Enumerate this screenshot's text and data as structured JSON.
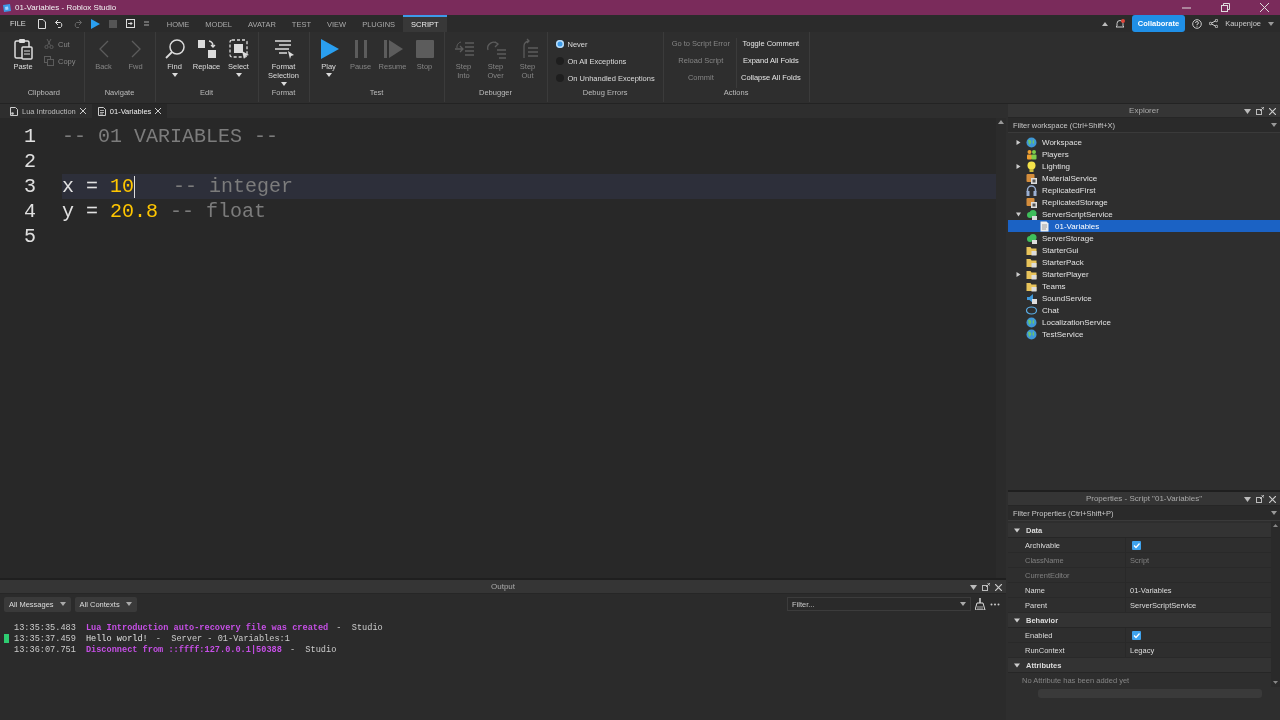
{
  "window": {
    "title": "01-Variables - Roblox Studio"
  },
  "menubar": {
    "file": "FILE",
    "tabs": [
      {
        "label": "HOME",
        "selected": false
      },
      {
        "label": "MODEL",
        "selected": false
      },
      {
        "label": "AVATAR",
        "selected": false
      },
      {
        "label": "TEST",
        "selected": false
      },
      {
        "label": "VIEW",
        "selected": false
      },
      {
        "label": "PLUGINS",
        "selected": false
      },
      {
        "label": "SCRIPT",
        "selected": true
      }
    ]
  },
  "account": {
    "collaborate": "Collaborate",
    "user": "Kaupenjoe"
  },
  "ribbon": {
    "groups": [
      {
        "label": "Clipboard",
        "tools": [
          {
            "kind": "large",
            "label": "Paste",
            "disabled": false,
            "dropdown": false
          },
          {
            "kind": "small",
            "label": "Cut",
            "disabled": true
          },
          {
            "kind": "small",
            "label": "Copy",
            "disabled": true
          }
        ]
      },
      {
        "label": "Navigate",
        "tools": [
          {
            "kind": "large",
            "label": "Back",
            "disabled": true,
            "dropdown": false
          },
          {
            "kind": "large",
            "label": "Fwd",
            "disabled": true,
            "dropdown": false
          }
        ]
      },
      {
        "label": "Edit",
        "tools": [
          {
            "kind": "large",
            "label": "Find",
            "disabled": false,
            "dropdown": true
          },
          {
            "kind": "large",
            "label": "Replace",
            "disabled": false,
            "dropdown": false
          },
          {
            "kind": "large",
            "label": "Select",
            "disabled": false,
            "dropdown": true
          }
        ]
      },
      {
        "label": "Format",
        "tools": [
          {
            "kind": "large",
            "label": "Format Selection",
            "disabled": false,
            "dropdown": true
          }
        ]
      },
      {
        "label": "Test",
        "tools": [
          {
            "kind": "large",
            "label": "Play",
            "disabled": false,
            "dropdown": true
          },
          {
            "kind": "large",
            "label": "Pause",
            "disabled": true,
            "dropdown": false
          },
          {
            "kind": "large",
            "label": "Resume",
            "disabled": true,
            "dropdown": false
          },
          {
            "kind": "large",
            "label": "Stop",
            "disabled": true,
            "dropdown": false
          }
        ]
      },
      {
        "label": "Debugger",
        "tools": [
          {
            "kind": "large",
            "label": "Step Into",
            "disabled": true,
            "dropdown": false
          },
          {
            "kind": "large",
            "label": "Step Over",
            "disabled": true,
            "dropdown": false
          },
          {
            "kind": "large",
            "label": "Step Out",
            "disabled": true,
            "dropdown": false
          }
        ]
      },
      {
        "label": "Debug Errors",
        "tools": [
          {
            "kind": "radio",
            "label": "Never",
            "selected": true
          },
          {
            "kind": "radio",
            "label": "On All Exceptions",
            "selected": false
          },
          {
            "kind": "radio",
            "label": "On Unhandled Exceptions",
            "selected": false
          }
        ]
      },
      {
        "label": "Actions",
        "tools": [
          {
            "kind": "text",
            "label": "Go to Script Error",
            "disabled": true
          },
          {
            "kind": "text",
            "label": "Reload Script",
            "disabled": true
          },
          {
            "kind": "text",
            "label": "Commit",
            "disabled": true
          },
          {
            "kind": "text",
            "label": "Toggle Comment",
            "disabled": false
          },
          {
            "kind": "text",
            "label": "Expand All Folds",
            "disabled": false
          },
          {
            "kind": "text",
            "label": "Collapse All Folds",
            "disabled": false
          }
        ]
      }
    ]
  },
  "editor": {
    "tabs": [
      {
        "label": "Lua Introduction",
        "selected": false
      },
      {
        "label": "01-Variables",
        "selected": true
      }
    ],
    "lines": [
      {
        "number": "1",
        "current": false,
        "tokens": [
          {
            "kind": "comment",
            "text": "-- 01 VARIABLES --"
          }
        ]
      },
      {
        "number": "2",
        "current": false
      },
      {
        "number": "3",
        "current": true,
        "tokens": [
          {
            "kind": "plain",
            "text": "x ="
          },
          {
            "kind": "number",
            "text": "10"
          },
          {
            "kind": "comment",
            "text": "-- integer"
          }
        ]
      },
      {
        "number": "4",
        "current": false,
        "tokens": [
          {
            "kind": "plain",
            "text": "y ="
          },
          {
            "kind": "number",
            "text": "20.8"
          },
          {
            "kind": "comment",
            "text": "-- float"
          }
        ]
      },
      {
        "number": "5",
        "current": false
      }
    ]
  },
  "output": {
    "title": "Output",
    "message_filter": "All Messages",
    "context_filter": "All Contexts",
    "filter_placeholder": "Filter...",
    "messages": [
      {
        "time": "13:35:35.483",
        "text": "Lua Introduction auto-recovery file was created",
        "kind": "system",
        "source": "-  Studio",
        "marked": false
      },
      {
        "time": "13:35:37.459",
        "text": "Hello world!",
        "kind": "print",
        "source": "-  Server - 01-Variables:1",
        "marked": true
      },
      {
        "time": "13:36:07.751",
        "text": "Disconnect from ::ffff:127.0.0.1|50388",
        "kind": "system",
        "source": "-  Studio",
        "marked": false
      }
    ]
  },
  "explorer": {
    "title": "Explorer",
    "filter_placeholder": "Filter workspace (Ctrl+Shift+X)",
    "items": [
      {
        "label": "Workspace",
        "expanded": false,
        "selected": false
      },
      {
        "label": "Players",
        "selected": false
      },
      {
        "label": "Lighting",
        "expanded": false,
        "selected": false
      },
      {
        "label": "MaterialService",
        "selected": false
      },
      {
        "label": "ReplicatedFirst",
        "selected": false
      },
      {
        "label": "ReplicatedStorage",
        "selected": false
      },
      {
        "label": "ServerScriptService",
        "expanded": true,
        "selected": false,
        "children": [
          {
            "label": "01-Variables",
            "selected": true
          }
        ]
      },
      {
        "label": "ServerStorage",
        "selected": false
      },
      {
        "label": "StarterGui",
        "selected": false
      },
      {
        "label": "StarterPack",
        "selected": false
      },
      {
        "label": "StarterPlayer",
        "expanded": false,
        "selected": false
      },
      {
        "label": "Teams",
        "selected": false
      },
      {
        "label": "SoundService",
        "selected": false
      },
      {
        "label": "Chat",
        "selected": false
      },
      {
        "label": "LocalizationService",
        "selected": false
      },
      {
        "label": "TestService",
        "selected": false
      }
    ]
  },
  "properties": {
    "title": "Properties - Script \"01-Variables\"",
    "filter_placeholder": "Filter Properties (Ctrl+Shift+P)",
    "sections": [
      {
        "title": "Data",
        "expanded": true,
        "rows": [
          {
            "name": "Archivable",
            "kind": "check",
            "checked": true,
            "disabled": false
          },
          {
            "name": "ClassName",
            "kind": "text",
            "value": "Script",
            "disabled": true
          },
          {
            "name": "CurrentEditor",
            "kind": "text",
            "disabled": true
          },
          {
            "name": "Name",
            "kind": "text",
            "value": "01-Variables",
            "disabled": false
          },
          {
            "name": "Parent",
            "kind": "text",
            "value": "ServerScriptService",
            "disabled": false
          }
        ]
      },
      {
        "title": "Behavior",
        "expanded": true,
        "rows": [
          {
            "name": "Enabled",
            "kind": "check",
            "checked": true,
            "disabled": false
          },
          {
            "name": "RunContext",
            "kind": "text",
            "value": "Legacy",
            "disabled": false
          }
        ]
      },
      {
        "title": "Attributes",
        "expanded": true,
        "note": "No Attribute has been added yet"
      }
    ]
  }
}
